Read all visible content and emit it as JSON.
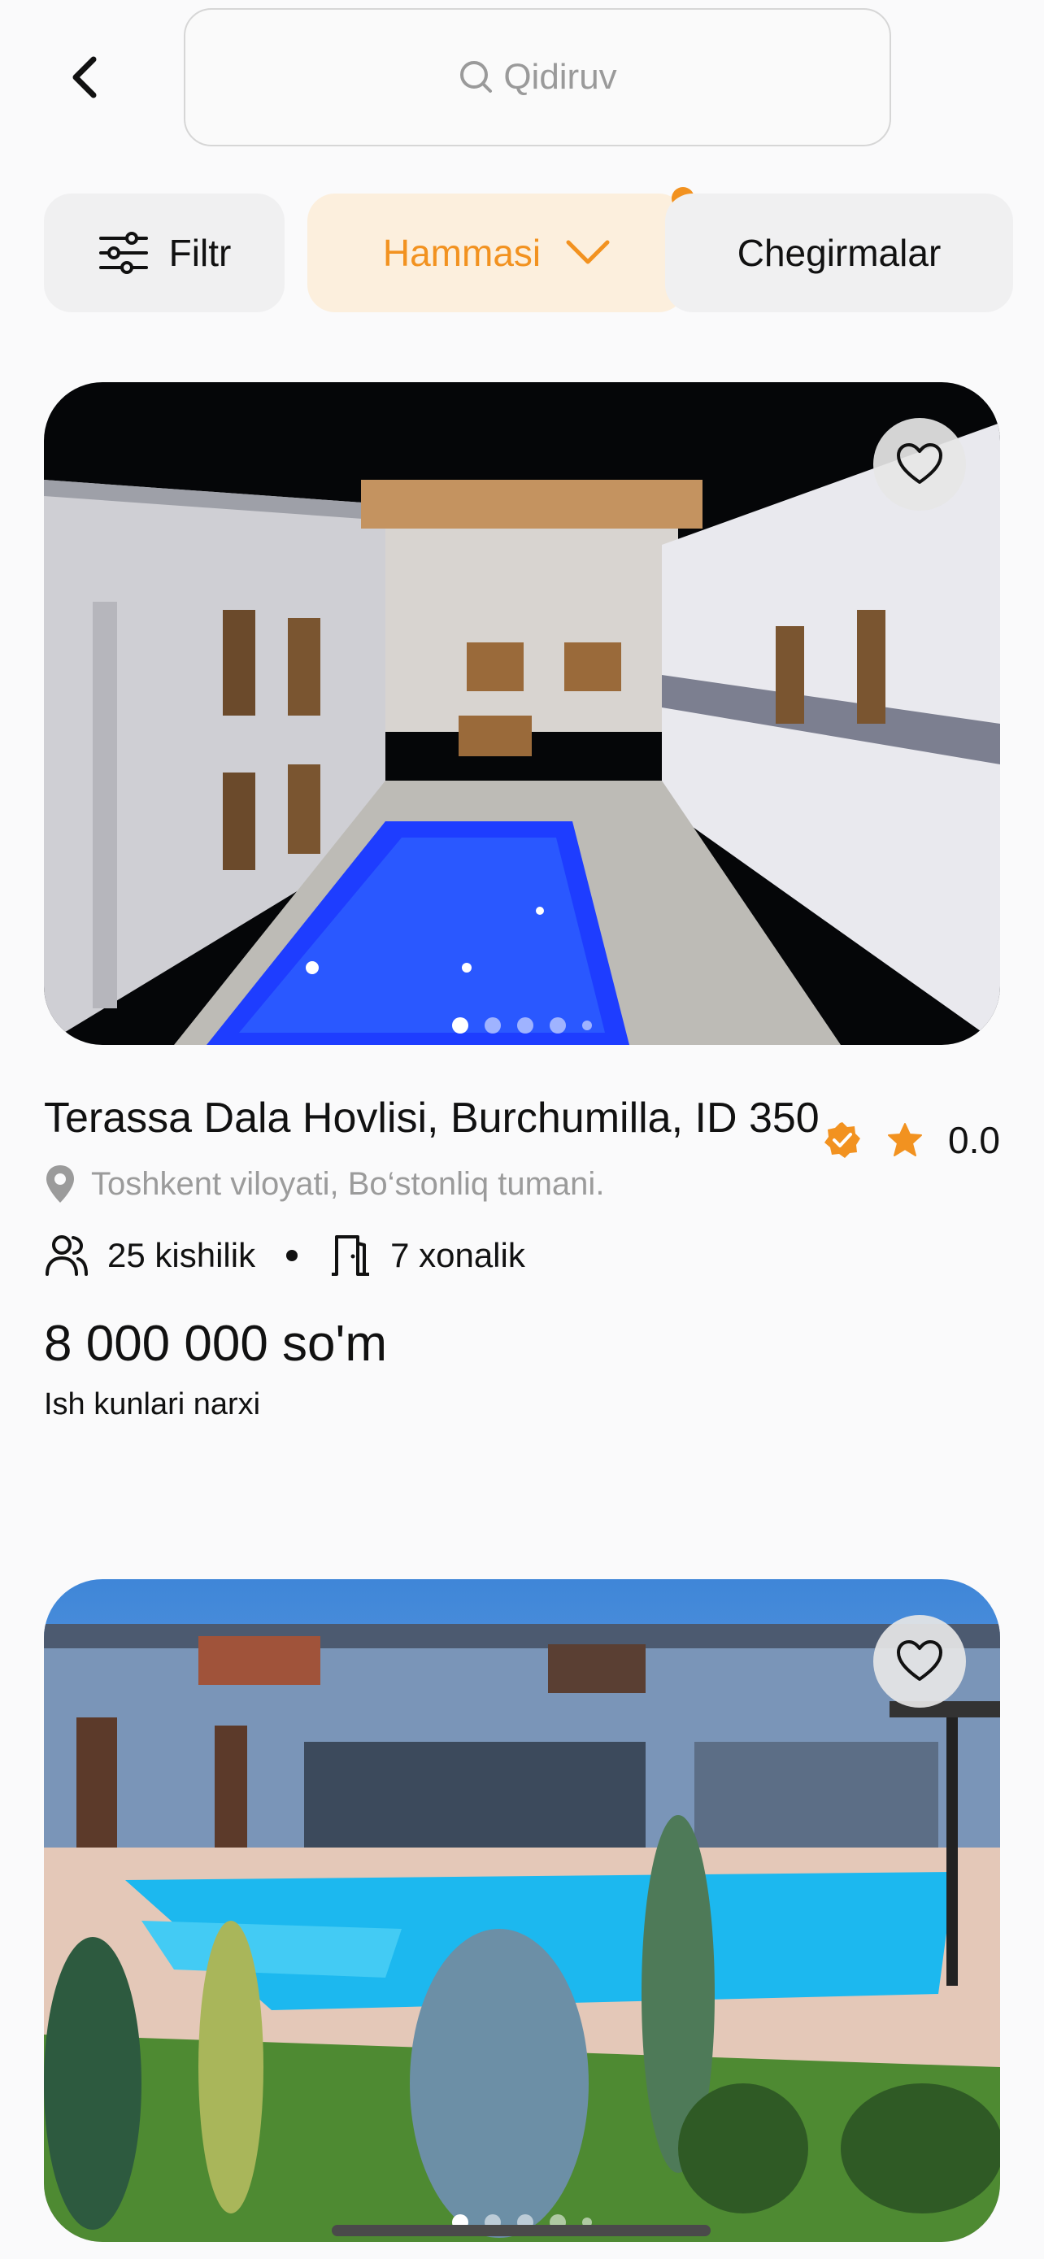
{
  "search": {
    "placeholder": "Qidiruv",
    "icon": "search-icon"
  },
  "filters": {
    "filter_label": "Filtr",
    "category_label": "Hammasi",
    "discounts_label": "Chegirmalar"
  },
  "colors": {
    "accent": "#F29220",
    "accent_bg": "#FCEFDD",
    "chip_bg": "#F0F0F1"
  },
  "listings": [
    {
      "title": "Terassa Dala Hovlisi, Burchumilla, ID 350",
      "rating": "0.0",
      "verified": true,
      "address": "Toshkent viloyati, Bo‘stonliq tumani.",
      "capacity": "25 kishilik",
      "rooms": "7 xonalik",
      "price": "8 000 000 so'm",
      "price_note": "Ish kunlari narxi",
      "images_count": 5,
      "active_image": 1
    },
    {
      "images_count": 5,
      "active_image": 1
    }
  ]
}
